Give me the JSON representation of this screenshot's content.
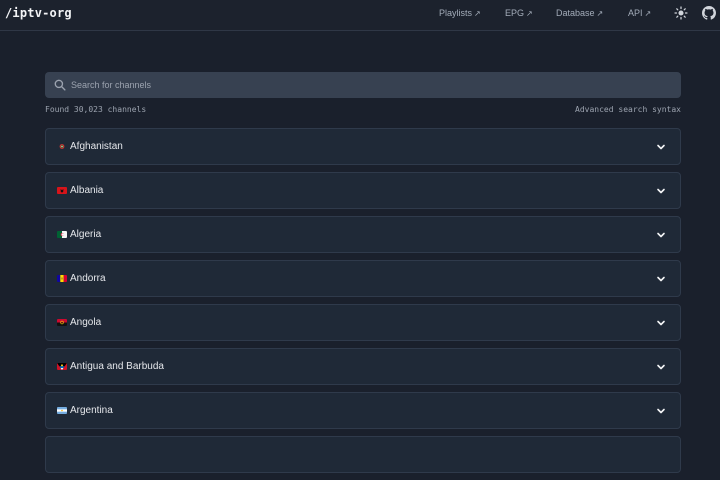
{
  "header": {
    "logo": "/iptv-org",
    "links": [
      {
        "label": "Playlists",
        "arrow": "↗"
      },
      {
        "label": "EPG",
        "arrow": "↗"
      },
      {
        "label": "Database",
        "arrow": "↗"
      },
      {
        "label": "API",
        "arrow": "↗"
      }
    ],
    "icons": [
      "sun-icon",
      "github-icon"
    ]
  },
  "search": {
    "placeholder": "Search for channels",
    "value": ""
  },
  "meta": {
    "found": "Found 30,023 channels",
    "advanced": "Advanced search syntax"
  },
  "countries": [
    {
      "name": "Afghanistan",
      "flag": "afghanistan-flag-icon"
    },
    {
      "name": "Albania",
      "flag": "albania-flag-icon"
    },
    {
      "name": "Algeria",
      "flag": "algeria-flag-icon"
    },
    {
      "name": "Andorra",
      "flag": "andorra-flag-icon"
    },
    {
      "name": "Angola",
      "flag": "angola-flag-icon"
    },
    {
      "name": "Antigua and Barbuda",
      "flag": "antigua-flag-icon"
    },
    {
      "name": "Argentina",
      "flag": "argentina-flag-icon"
    }
  ],
  "colors": {
    "background": "#1a202c",
    "card": "#1f2937",
    "search_bg": "#374151"
  }
}
